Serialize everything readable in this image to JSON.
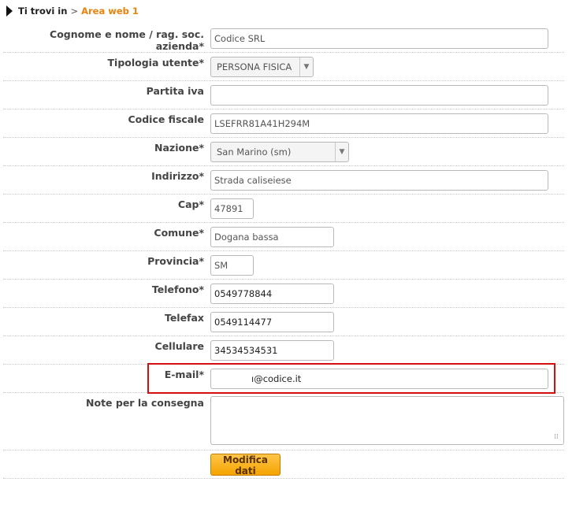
{
  "breadcrumb": {
    "prefix": "Ti trovi in",
    "separator": ">",
    "current": "Area web 1"
  },
  "form": {
    "ragione_sociale": {
      "label": "Cognome e nome / rag. soc. azienda*",
      "value": "Codice SRL"
    },
    "tipologia": {
      "label": "Tipologia utente*",
      "value": "PERSONA FISICA"
    },
    "partita_iva": {
      "label": "Partita iva",
      "value": ""
    },
    "codice_fiscale": {
      "label": "Codice fiscale",
      "value": "LSEFRR81A41H294M"
    },
    "nazione": {
      "label": "Nazione*",
      "value": "San Marino (sm)"
    },
    "indirizzo": {
      "label": "Indirizzo*",
      "value": "Strada caliseiese"
    },
    "cap": {
      "label": "Cap*",
      "value": "47891"
    },
    "comune": {
      "label": "Comune*",
      "value": "Dogana bassa"
    },
    "provincia": {
      "label": "Provincia*",
      "value": "SM"
    },
    "telefono": {
      "label": "Telefono*",
      "value": "0549778844"
    },
    "telefax": {
      "label": "Telefax",
      "value": "0549114477"
    },
    "cellulare": {
      "label": "Cellulare",
      "value": "34534534531"
    },
    "email": {
      "label": "E-mail*",
      "value": "ı@codice.it"
    },
    "note": {
      "label": "Note per la consegna",
      "value": ""
    },
    "submit_label": "Modifica dati"
  },
  "colors": {
    "accent": "#e8830f",
    "button": "#f5a300",
    "highlight": "#d40f0f"
  }
}
